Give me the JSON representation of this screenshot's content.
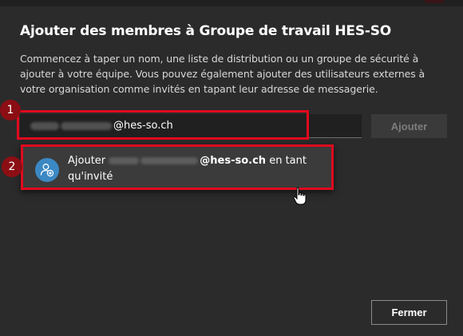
{
  "dialog": {
    "title": "Ajouter des membres à Groupe de travail HES-SO",
    "description": "Commencez à taper un nom, une liste de distribution ou un groupe de sécurité à ajouter à votre équipe. Vous pouvez également ajouter des utilisateurs externes à votre organisation comme invités en tapant leur adresse de messagerie."
  },
  "input": {
    "value_suffix": "@hes-so.ch"
  },
  "add_button": {
    "label": "Ajouter"
  },
  "suggestion": {
    "prefix": "Ajouter",
    "email_suffix": "@hes-so.ch",
    "suffix_line1": "en tant",
    "suffix_line2": "qu'invité",
    "avatar_icon": "add-person-icon"
  },
  "annotations": {
    "step1": "1",
    "step2": "2",
    "color": "#e00a1e"
  },
  "close_button": {
    "label": "Fermer"
  }
}
